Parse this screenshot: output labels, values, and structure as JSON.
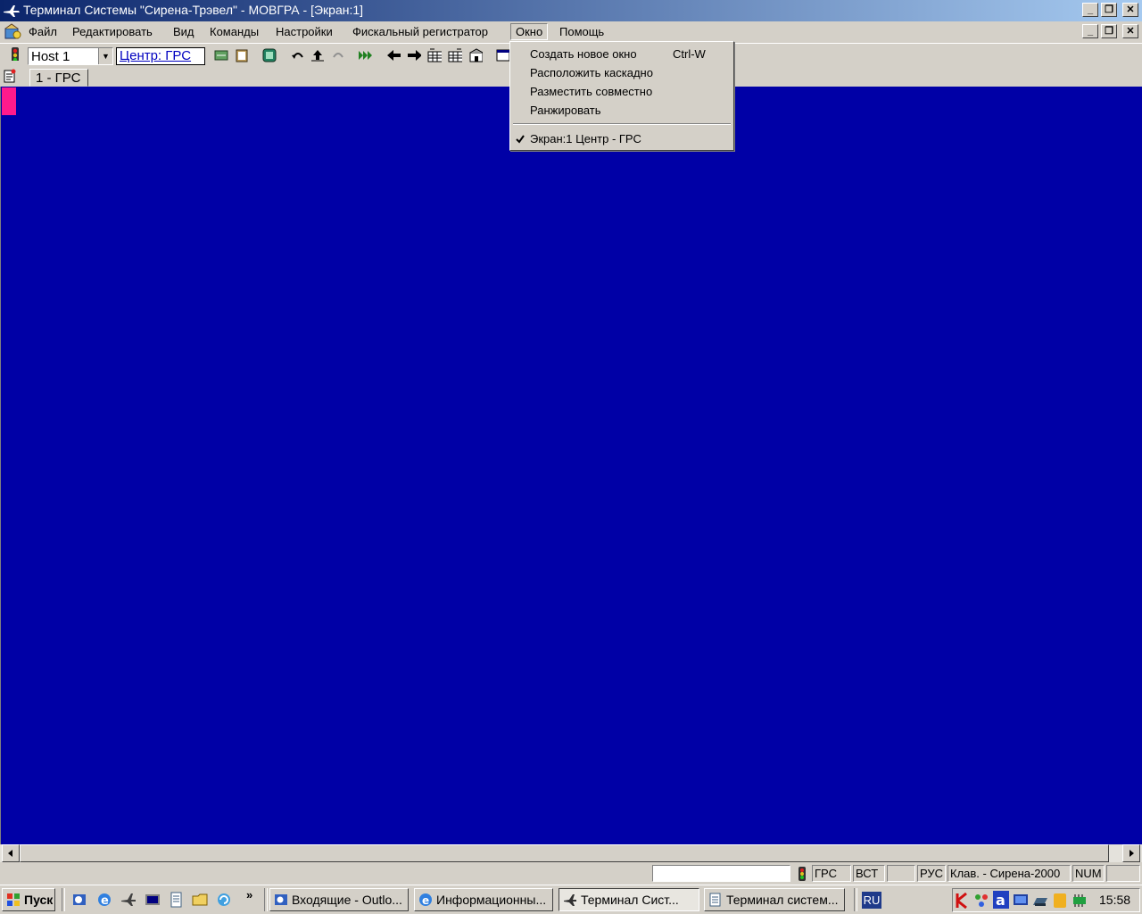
{
  "window": {
    "title": "Терминал Системы \"Сирена-Трэвел\" - МОВГРА - [Экран:1]"
  },
  "menubar": {
    "items": [
      "Файл",
      "Редактировать",
      "Вид",
      "Команды",
      "Настройки",
      "Фискальный регистратор",
      "Окно",
      "Помощь"
    ],
    "active": "Окно"
  },
  "toolbar": {
    "host_value": "Host 1",
    "center_label": "Центр: ГРС"
  },
  "tabs": [
    {
      "label": "1 - ГРС"
    }
  ],
  "window_menu": {
    "items": [
      {
        "label": "Создать новое окно",
        "shortcut": "Ctrl-W",
        "checked": false
      },
      {
        "label": "Расположить каскадно",
        "shortcut": "",
        "checked": false
      },
      {
        "label": "Разместить совместно",
        "shortcut": "",
        "checked": false
      },
      {
        "label": "Ранжировать",
        "shortcut": "",
        "checked": false
      },
      {
        "label": "Экран:1  Центр - ГРС",
        "shortcut": "",
        "checked": true
      }
    ]
  },
  "colors": {
    "screen_bg": "#0000a6",
    "cursor": "#ff1a8c"
  },
  "statusbar": {
    "input_value": "",
    "center": "ГРС",
    "insert_mode": "ВСТ",
    "lang": "РУС",
    "keyboard": "Клав. - Сирена-2000",
    "num": "NUM"
  },
  "taskbar": {
    "start_label": "Пуск",
    "more": "»",
    "tasks": [
      {
        "label": "Входящие - Outlo...",
        "icon": "outlook-icon",
        "active": false
      },
      {
        "label": "Информационны...",
        "icon": "ie-icon",
        "active": false
      },
      {
        "label": "Терминал Сист...",
        "icon": "plane-icon",
        "active": true
      },
      {
        "label": "Терминал систем...",
        "icon": "document-icon",
        "active": false
      }
    ],
    "lang_indicator": "RU",
    "clock": "15:58"
  }
}
